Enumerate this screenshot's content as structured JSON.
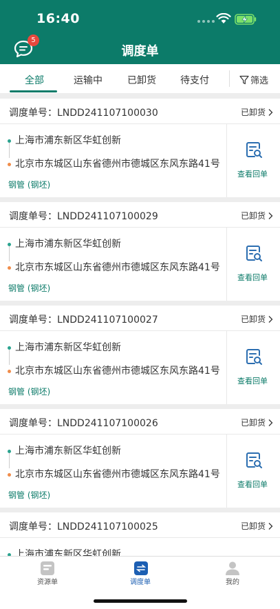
{
  "status_bar": {
    "time": "16:40"
  },
  "header": {
    "title": "调度单",
    "message_badge": "5"
  },
  "tabs": {
    "items": [
      {
        "label": "全部",
        "active": true
      },
      {
        "label": "运输中",
        "active": false
      },
      {
        "label": "已卸货",
        "active": false
      },
      {
        "label": "待支付",
        "active": false
      }
    ],
    "filter_label": "筛选"
  },
  "orders": [
    {
      "prefix": "调度单号：",
      "number": "LNDD241107100030",
      "status": "已卸货",
      "from": "上海市浦东新区华虹创新",
      "to": "北京市东城区山东省德州市德城区东风东路41号",
      "cargo": "钢管 (钢坯)",
      "action": "查看回单"
    },
    {
      "prefix": "调度单号：",
      "number": "LNDD241107100029",
      "status": "已卸货",
      "from": "上海市浦东新区华虹创新",
      "to": "北京市东城区山东省德州市德城区东风东路41号",
      "cargo": "钢管 (钢坯)",
      "action": "查看回单"
    },
    {
      "prefix": "调度单号：",
      "number": "LNDD241107100027",
      "status": "已卸货",
      "from": "上海市浦东新区华虹创新",
      "to": "北京市东城区山东省德州市德城区东风东路41号",
      "cargo": "钢管 (钢坯)",
      "action": "查看回单"
    },
    {
      "prefix": "调度单号：",
      "number": "LNDD241107100026",
      "status": "已卸货",
      "from": "上海市浦东新区华虹创新",
      "to": "北京市东城区山东省德州市德城区东风东路41号",
      "cargo": "钢管 (钢坯)",
      "action": "查看回单"
    },
    {
      "prefix": "调度单号：",
      "number": "LNDD241107100025",
      "status": "已卸货",
      "from": "上海市浦东新区华虹创新",
      "to": "",
      "cargo": "",
      "action": ""
    }
  ],
  "tabbar": {
    "items": [
      {
        "label": "资源单",
        "icon": "document-icon"
      },
      {
        "label": "调度单",
        "icon": "swap-icon",
        "active": true
      },
      {
        "label": "我的",
        "icon": "person-icon"
      }
    ]
  },
  "colors": {
    "brand": "#0c7b69",
    "active_tab": "#1c5fb3",
    "badge": "#e6483d"
  }
}
